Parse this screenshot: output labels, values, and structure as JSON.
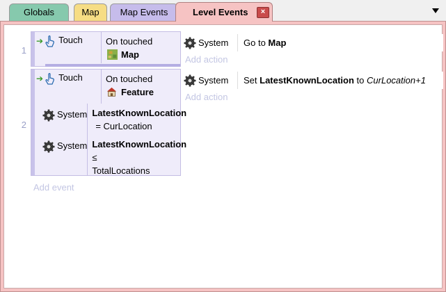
{
  "tabs": [
    {
      "label": "Globals"
    },
    {
      "label": "Map"
    },
    {
      "label": "Map Events"
    },
    {
      "label": "Level Events",
      "close": "×"
    }
  ],
  "events": [
    {
      "number": "1",
      "conditions": [
        {
          "object": "Touch",
          "text1": "On touched",
          "target": "Map"
        }
      ],
      "actions": [
        {
          "object": "System",
          "text_prefix": "Go to",
          "text_bold": "Map"
        }
      ],
      "add_action": "Add action"
    },
    {
      "number": "2",
      "conditions": [
        {
          "object": "Touch",
          "text1": "On touched",
          "target": "Feature"
        },
        {
          "object": "System",
          "var": "LatestKnownLocation",
          "op": "= CurLocation"
        },
        {
          "object": "System",
          "var": "LatestKnownLocation",
          "op": "≤",
          "rhs": "TotalLocations"
        }
      ],
      "actions": [
        {
          "object": "System",
          "text_prefix": "Set",
          "text_bold": "LatestKnownLocation",
          "text_mid": "to",
          "text_italic": "CurLocation+1"
        }
      ],
      "add_action": "Add action"
    }
  ],
  "add_event": "Add event"
}
